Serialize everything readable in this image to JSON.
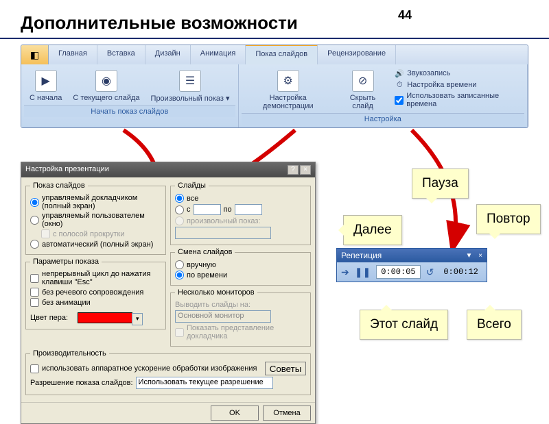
{
  "page": {
    "number": "44",
    "title": "Дополнительные возможности"
  },
  "ribbon": {
    "tabs": [
      "Главная",
      "Вставка",
      "Дизайн",
      "Анимация",
      "Показ слайдов",
      "Рецензирование"
    ],
    "active_index": 4,
    "group_start": {
      "name": "Начать показ слайдов",
      "btn_from_start": "С начала",
      "btn_from_current": "С текущего слайда",
      "btn_custom": "Произвольный показ ▾"
    },
    "group_setup": {
      "name": "Настройка",
      "btn_setup": "Настройка демонстрации",
      "btn_hide": "Скрыть слайд",
      "item_record": "Звукозапись",
      "item_time": "Настройка времени",
      "item_use_timings": "Использовать записанные времена"
    }
  },
  "dialog": {
    "title": "Настройка презентации",
    "grp_show": "Показ слайдов",
    "opt_speaker": "управляемый докладчиком (полный экран)",
    "opt_browsed": "управляемый пользователем (окно)",
    "opt_scrollbar": "с полосой прокрутки",
    "opt_kiosk": "автоматический (полный экран)",
    "grp_slides": "Слайды",
    "slides_all": "все",
    "slides_from": "с",
    "slides_to": "по",
    "slides_custom": "произвольный показ:",
    "grp_options": "Параметры показа",
    "opt_loop": "непрерывный цикл до нажатия клавиши \"Esc\"",
    "opt_no_narration": "без речевого сопровождения",
    "opt_no_anim": "без анимации",
    "pen_label": "Цвет пера:",
    "grp_advance": "Смена слайдов",
    "adv_manual": "вручную",
    "adv_time": "по времени",
    "grp_monitors": "Несколько мониторов",
    "mon_label": "Выводить слайды на:",
    "mon_value": "Основной монитор",
    "mon_presenter": "Показать представление докладчика",
    "grp_perf": "Производительность",
    "perf_accel": "использовать аппаратное ускорение обработки изображения",
    "perf_tips": "Советы",
    "perf_res_label": "Разрешение показа слайдов:",
    "perf_res_value": "Использовать текущее разрешение",
    "btn_ok": "OK",
    "btn_cancel": "Отмена"
  },
  "rehearsal": {
    "title": "Репетиция",
    "slide_time": "0:00:05",
    "total_time": "0:00:12"
  },
  "callouts": {
    "next": "Далее",
    "pause": "Пауза",
    "repeat": "Повтор",
    "this_slide": "Этот слайд",
    "total": "Всего"
  }
}
